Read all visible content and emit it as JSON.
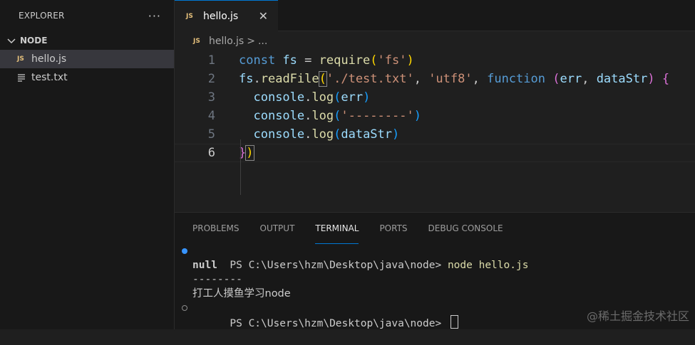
{
  "sidebar": {
    "title": "EXPLORER",
    "more_label": "···",
    "folder": "NODE",
    "files": [
      {
        "name": "hello.js",
        "badge": "JS"
      },
      {
        "name": "test.txt"
      }
    ]
  },
  "tab": {
    "name": "hello.js",
    "badge": "JS",
    "close": "✕"
  },
  "breadcrumb": {
    "badge": "JS",
    "file": "hello.js",
    "sep": ">",
    "rest": "..."
  },
  "line_numbers": [
    "1",
    "2",
    "3",
    "4",
    "5",
    "6"
  ],
  "code": {
    "l1": {
      "kw": "const",
      "v": " fs",
      "eq": " = ",
      "fn": "require",
      "p1": "(",
      "s": "'fs'",
      "p2": ")"
    },
    "l2": {
      "v": "fs",
      "dot": ".",
      "fn": "readFile",
      "p1": "(",
      "s1": "'./test.txt'",
      "c1": ", ",
      "s2": "'utf8'",
      "c2": ", ",
      "kw": "function",
      "sp": " ",
      "p2": "(",
      "a1": "err",
      "c3": ", ",
      "a2": "dataStr",
      "p3": ")",
      "sp2": " ",
      "b": "{"
    },
    "l3": {
      "ind": "  ",
      "v": "console",
      "dot": ".",
      "fn": "log",
      "p1": "(",
      "a": "err",
      "p2": ")"
    },
    "l4": {
      "ind": "  ",
      "v": "console",
      "dot": ".",
      "fn": "log",
      "p1": "(",
      "s": "'--------'",
      "p2": ")"
    },
    "l5": {
      "ind": "  ",
      "v": "console",
      "dot": ".",
      "fn": "log",
      "p1": "(",
      "a": "dataStr",
      "p2": ")"
    },
    "l6": {
      "b": "}",
      "p": ")"
    }
  },
  "panel": {
    "tabs": [
      "PROBLEMS",
      "OUTPUT",
      "TERMINAL",
      "PORTS",
      "DEBUG CONSOLE"
    ],
    "active_tab": "TERMINAL"
  },
  "terminal": {
    "prompt": "PS C:\\Users\\hzm\\Desktop\\java\\node> ",
    "command": "node hello.js",
    "out1": "null",
    "out2": "--------",
    "out3": "打工人摸鱼学习node",
    "prompt2": "PS C:\\Users\\hzm\\Desktop\\java\\node> "
  },
  "watermark": "@稀土掘金技术社区",
  "colors": {
    "accent": "#0078d4",
    "js_badge": "#e5c07b",
    "keyword": "#569cd6",
    "string": "#ce9178",
    "function": "#dcdcaa"
  }
}
